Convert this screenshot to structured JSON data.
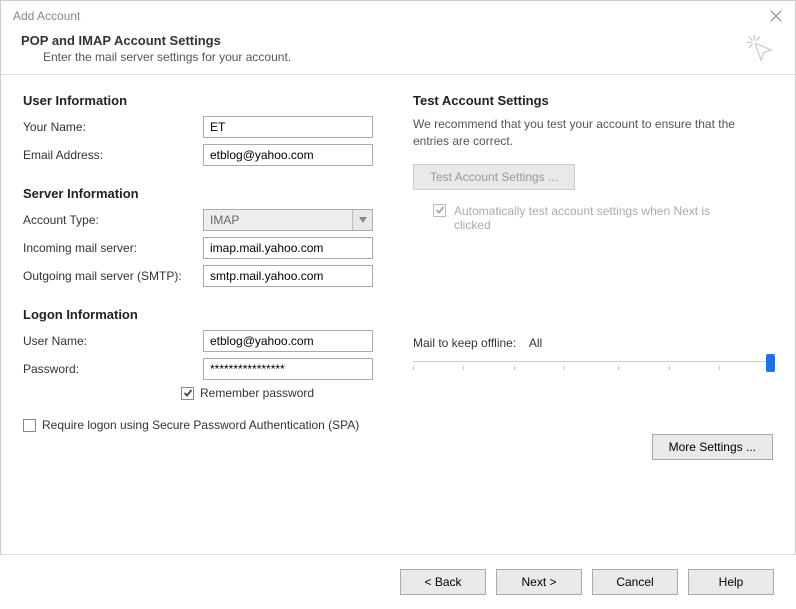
{
  "window": {
    "title": "Add Account"
  },
  "header": {
    "title": "POP and IMAP Account Settings",
    "subtitle": "Enter the mail server settings for your account."
  },
  "left": {
    "user_info_title": "User Information",
    "your_name_label": "Your Name:",
    "your_name_value": "ET",
    "email_label": "Email Address:",
    "email_value": "etblog@yahoo.com",
    "server_info_title": "Server Information",
    "account_type_label": "Account Type:",
    "account_type_value": "IMAP",
    "incoming_label": "Incoming mail server:",
    "incoming_value": "imap.mail.yahoo.com",
    "outgoing_label": "Outgoing mail server (SMTP):",
    "outgoing_value": "smtp.mail.yahoo.com",
    "logon_info_title": "Logon Information",
    "username_label": "User Name:",
    "username_value": "etblog@yahoo.com",
    "password_label": "Password:",
    "password_value": "****************",
    "remember_pw_label": "Remember password",
    "spa_label": "Require logon using Secure Password Authentication (SPA)"
  },
  "right": {
    "test_title": "Test Account Settings",
    "test_desc": "We recommend that you test your account to ensure that the entries are correct.",
    "test_button": "Test Account Settings ...",
    "auto_test_label": "Automatically test account settings when Next is clicked",
    "mail_offline_label": "Mail to keep offline:",
    "mail_offline_value": "All",
    "more_settings": "More Settings ..."
  },
  "footer": {
    "back": "< Back",
    "next": "Next >",
    "cancel": "Cancel",
    "help": "Help"
  }
}
